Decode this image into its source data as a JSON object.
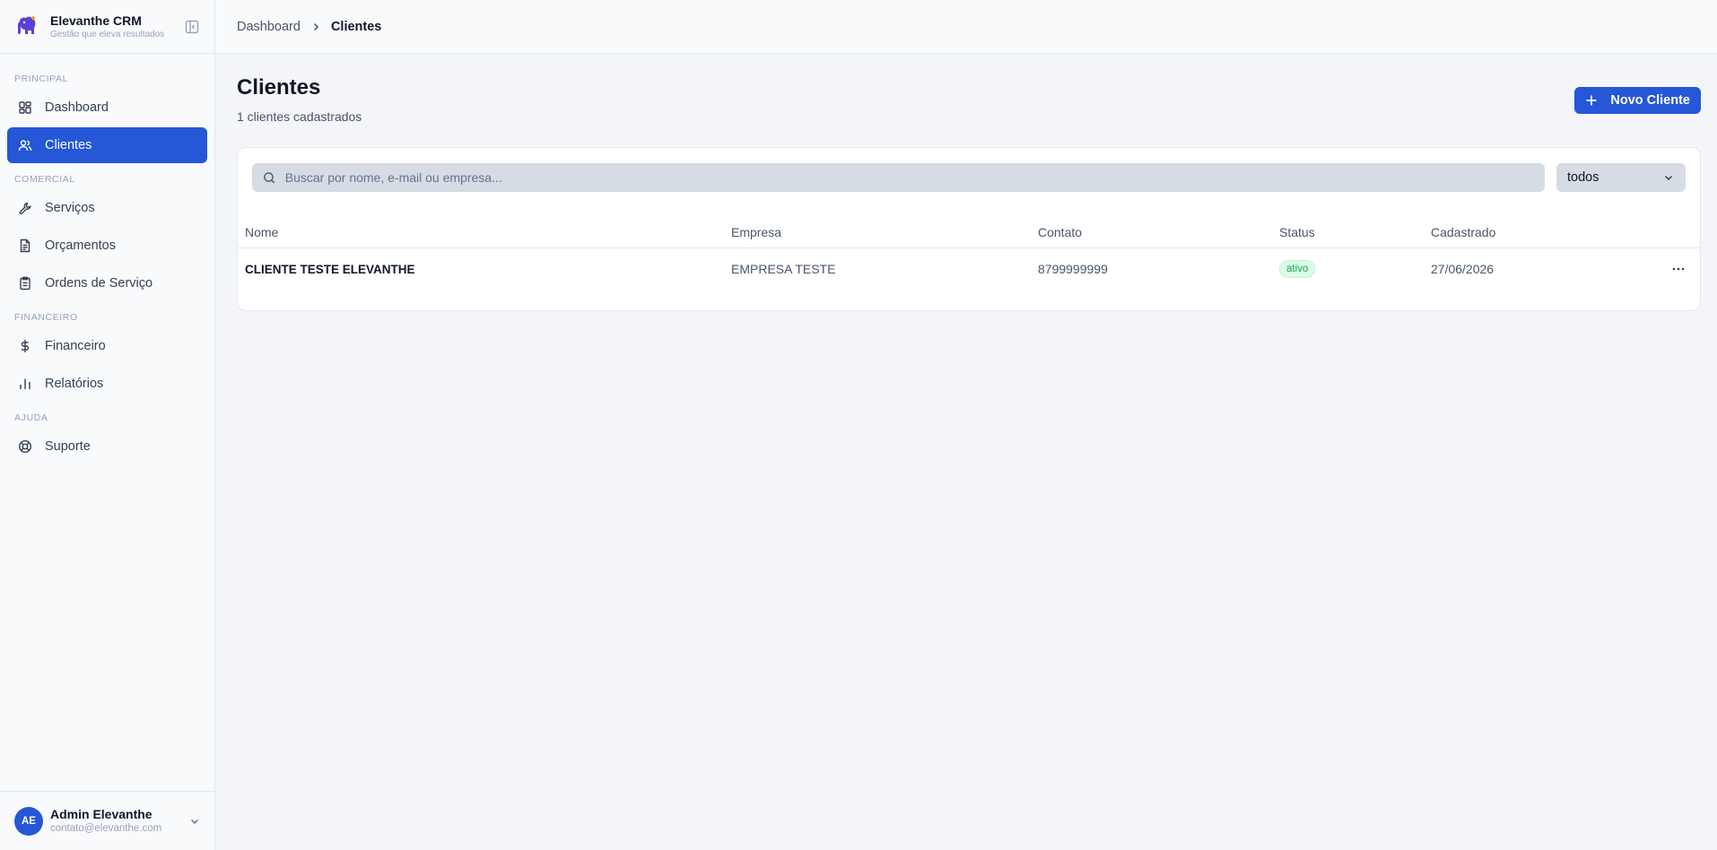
{
  "brand": {
    "name": "Elevanthe CRM",
    "tagline": "Gestão que eleva resultados"
  },
  "sidebar": {
    "sections": [
      {
        "title": "PRINCIPAL",
        "items": [
          {
            "label": "Dashboard",
            "icon": "dashboard-icon"
          },
          {
            "label": "Clientes",
            "icon": "users-icon",
            "active": true
          }
        ]
      },
      {
        "title": "COMERCIAL",
        "items": [
          {
            "label": "Serviços",
            "icon": "wrench-icon"
          },
          {
            "label": "Orçamentos",
            "icon": "file-text-icon"
          },
          {
            "label": "Ordens de Serviço",
            "icon": "clipboard-icon"
          }
        ]
      },
      {
        "title": "FINANCEIRO",
        "items": [
          {
            "label": "Financeiro",
            "icon": "dollar-icon"
          },
          {
            "label": "Relatórios",
            "icon": "bar-chart-icon"
          }
        ]
      },
      {
        "title": "AJUDA",
        "items": [
          {
            "label": "Suporte",
            "icon": "life-buoy-icon"
          }
        ]
      }
    ]
  },
  "user": {
    "initials": "AE",
    "name": "Admin Elevanthe",
    "email": "contato@elevanthe.com"
  },
  "breadcrumb": {
    "parent": "Dashboard",
    "current": "Clientes"
  },
  "page": {
    "title": "Clientes",
    "subtitle": "1 clientes cadastrados",
    "new_button": "Novo Cliente"
  },
  "filters": {
    "search_placeholder": "Buscar por nome, e-mail ou empresa...",
    "status_value": "todos"
  },
  "table": {
    "headers": {
      "nome": "Nome",
      "empresa": "Empresa",
      "contato": "Contato",
      "status": "Status",
      "cadastrado": "Cadastrado"
    },
    "rows": [
      {
        "nome": "CLIENTE TESTE ELEVANTHE",
        "empresa": "EMPRESA TESTE",
        "contato": "8799999999",
        "status": "ativo",
        "cadastrado": "27/06/2026"
      }
    ]
  },
  "colors": {
    "primary": "#2557d6",
    "success": "#16a34a",
    "background": "#f3f5f9"
  }
}
